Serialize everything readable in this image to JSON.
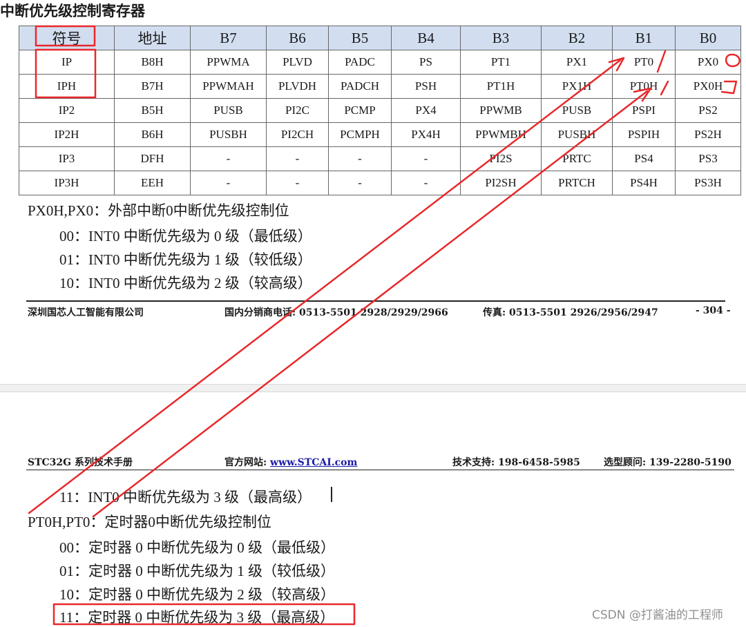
{
  "title": "中断优先级控制寄存器",
  "table": {
    "headers": [
      "符号",
      "地址",
      "B7",
      "B6",
      "B5",
      "B4",
      "B3",
      "B2",
      "B1",
      "B0"
    ],
    "rows": [
      [
        "IP",
        "B8H",
        "PPWMA",
        "PLVD",
        "PADC",
        "PS",
        "PT1",
        "PX1",
        "PT0",
        "PX0"
      ],
      [
        "IPH",
        "B7H",
        "PPWMAH",
        "PLVDH",
        "PADCH",
        "PSH",
        "PT1H",
        "PX1H",
        "PT0H",
        "PX0H"
      ],
      [
        "IP2",
        "B5H",
        "PUSB",
        "PI2C",
        "PCMP",
        "PX4",
        "PPWMB",
        "PUSB",
        "PSPI",
        "PS2"
      ],
      [
        "IP2H",
        "B6H",
        "PUSBH",
        "PI2CH",
        "PCMPH",
        "PX4H",
        "PPWMBH",
        "PUSBH",
        "PSPIH",
        "PS2H"
      ],
      [
        "IP3",
        "DFH",
        "-",
        "-",
        "-",
        "-",
        "PI2S",
        "PRTC",
        "PS4",
        "PS3"
      ],
      [
        "IP3H",
        "EEH",
        "-",
        "-",
        "-",
        "-",
        "PI2SH",
        "PRTCH",
        "PS4H",
        "PS3H"
      ]
    ]
  },
  "px0_section": {
    "heading": "PX0H,PX0：外部中断0中断优先级控制位",
    "lines": [
      "00：INT0 中断优先级为 0 级（最低级）",
      "01：INT0 中断优先级为 1 级（较低级）",
      "10：INT0 中断优先级为 2 级（较高级）"
    ]
  },
  "footer_bottom": {
    "company": "深圳国芯人工智能有限公司",
    "distributor_phone": "国内分销商电话: 0513-5501 2928/2929/2966",
    "fax": "传真: 0513-5501 2926/2956/2947",
    "page": "- 304 -"
  },
  "header_top": {
    "manual": "STC32G 系列技术手册",
    "website_label": "官方网站: ",
    "website_link": "www.STCAI.com",
    "support": "技术支持: 198-6458-5985",
    "selection": "选型顾问: 139-2280-5190"
  },
  "px0_continued": "11：INT0 中断优先级为 3 级（最高级）",
  "pt0_section": {
    "heading": "PT0H,PT0：定时器0中断优先级控制位",
    "lines": [
      "00：定时器 0 中断优先级为 0 级（最低级）",
      "01：定时器 0 中断优先级为 1 级（较低级）",
      "10：定时器 0 中断优先级为 2 级（较高级）",
      "11：定时器 0 中断优先级为 3 级（最高级）"
    ]
  },
  "watermark": "CSDN @打酱油的工程师",
  "annotation_color": "#e8282b"
}
